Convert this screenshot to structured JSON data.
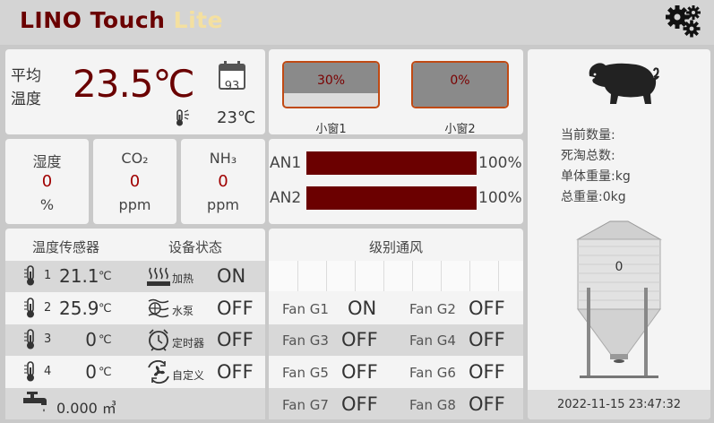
{
  "header": {
    "brand_main": "LINO Touch ",
    "brand_lite": "Lite",
    "icon": "gear-icon"
  },
  "avg_temp": {
    "label_line1": "平均",
    "label_line2": "温度",
    "value": "23.5℃",
    "calendar_day": "93",
    "outdoor_temp": "23℃"
  },
  "windows": [
    {
      "label": "小窗1",
      "value": "30%",
      "fill": 0.3
    },
    {
      "label": "小窗2",
      "value": "0%",
      "fill": 0.0
    }
  ],
  "gauges": [
    {
      "name": "湿度",
      "value": "0",
      "unit": "%"
    },
    {
      "name": "CO₂",
      "value": "0",
      "unit": "ppm"
    },
    {
      "name": "NH₃",
      "value": "0",
      "unit": "ppm"
    }
  ],
  "analog": [
    {
      "label": "AN1",
      "value": "100%",
      "level": 1.0
    },
    {
      "label": "AN2",
      "value": "100%",
      "level": 1.0
    }
  ],
  "sensors_panel": {
    "sensor_header": "温度传感器",
    "device_header": "设备状态",
    "sensors": [
      {
        "index": "1",
        "value": "21.1",
        "unit": "℃"
      },
      {
        "index": "2",
        "value": "25.9",
        "unit": "℃"
      },
      {
        "index": "3",
        "value": "0",
        "unit": "℃"
      },
      {
        "index": "4",
        "value": "0",
        "unit": "℃"
      }
    ],
    "devices": [
      {
        "name": "加热",
        "state": "ON",
        "icon": "heater-icon"
      },
      {
        "name": "水泵",
        "state": "OFF",
        "icon": "water-pump-icon"
      },
      {
        "name": "定时器",
        "state": "OFF",
        "icon": "timer-icon"
      },
      {
        "name": "自定义",
        "state": "OFF",
        "icon": "custom-fan-icon"
      }
    ],
    "water": "0.000 ㎥"
  },
  "ventilation": {
    "title": "级别通风",
    "fans": [
      {
        "name": "Fan G1",
        "state": "ON"
      },
      {
        "name": "Fan G2",
        "state": "OFF"
      },
      {
        "name": "Fan G3",
        "state": "OFF"
      },
      {
        "name": "Fan G4",
        "state": "OFF"
      },
      {
        "name": "Fan G5",
        "state": "OFF"
      },
      {
        "name": "Fan G6",
        "state": "OFF"
      },
      {
        "name": "Fan G7",
        "state": "OFF"
      },
      {
        "name": "Fan G8",
        "state": "OFF"
      }
    ]
  },
  "herd": {
    "count_label": "当前数量:",
    "dead_label": "死淘总数:",
    "unit_weight_label": "单体重量:kg",
    "total_weight_label": "总重量:0kg",
    "silo_value": "0",
    "datetime": "2022-11-15 23:47:32"
  }
}
